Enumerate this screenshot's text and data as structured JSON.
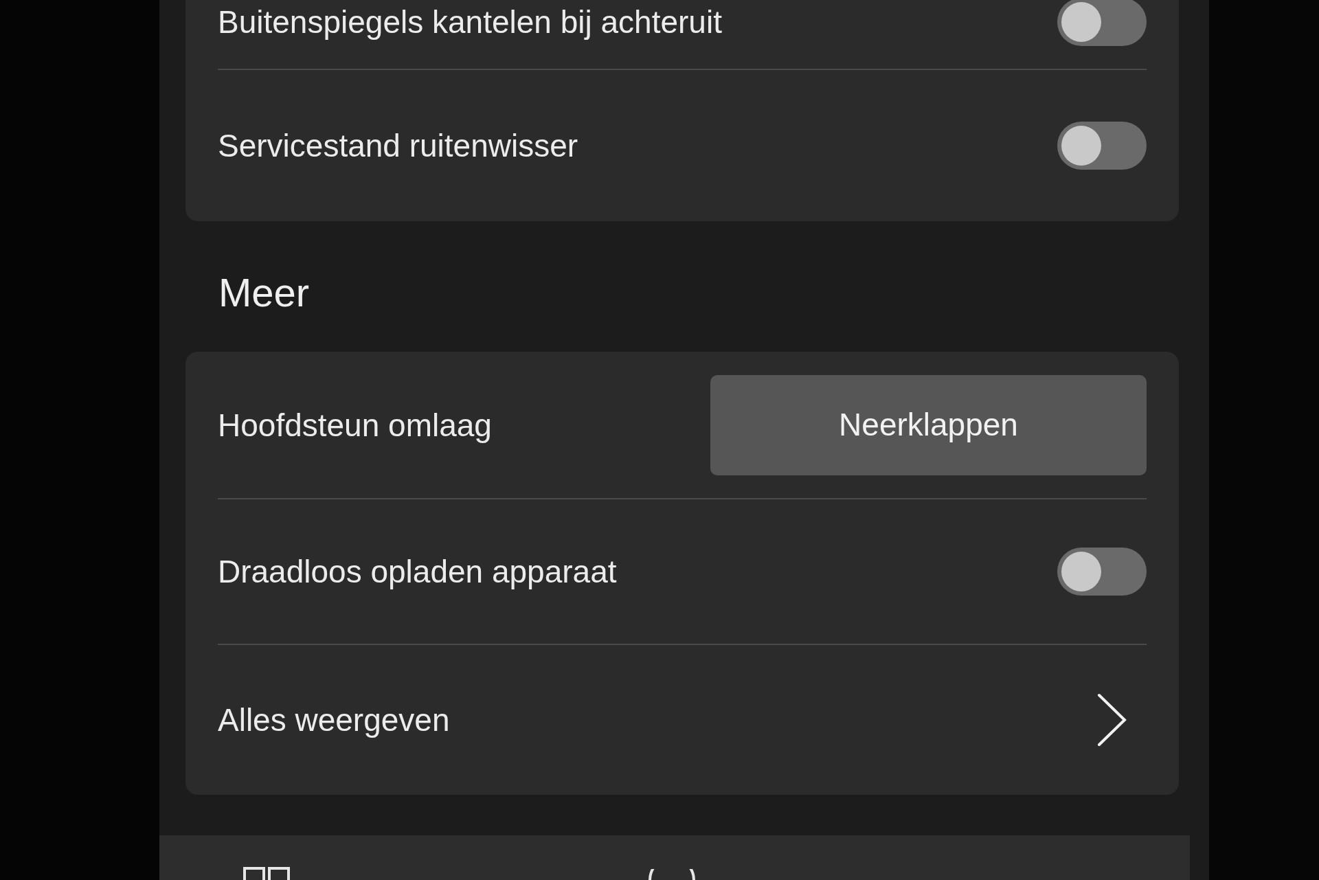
{
  "sections": [
    {
      "rows": [
        {
          "kind": "toggle",
          "label": "Buitenspiegels kantelen bij achteruit",
          "on": false
        },
        {
          "kind": "toggle",
          "label": "Servicestand ruitenwisser",
          "on": false
        }
      ]
    },
    {
      "title": "Meer",
      "rows": [
        {
          "kind": "button",
          "label": "Hoofdsteun omlaag",
          "button": "Neerklappen"
        },
        {
          "kind": "toggle",
          "label": "Draadloos opladen apparaat",
          "on": false
        },
        {
          "kind": "link",
          "label": "Alles weergeven"
        }
      ]
    }
  ]
}
